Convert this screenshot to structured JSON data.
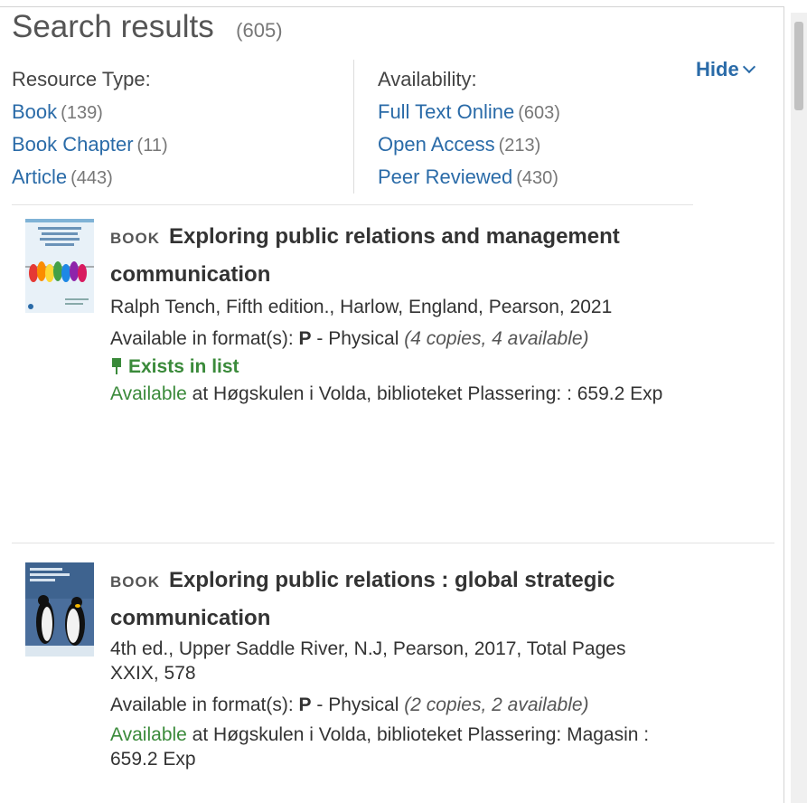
{
  "header": {
    "title": "Search results",
    "count": "(605)",
    "hide_label": "Hide"
  },
  "facets": {
    "resource_type": {
      "label": "Resource Type:",
      "items": [
        {
          "label": "Book",
          "count": "(139)"
        },
        {
          "label": "Book Chapter",
          "count": "(11)"
        },
        {
          "label": "Article",
          "count": "(443)"
        }
      ]
    },
    "availability": {
      "label": "Availability:",
      "items": [
        {
          "label": "Full Text Online",
          "count": "(603)"
        },
        {
          "label": "Open Access",
          "count": "(213)"
        },
        {
          "label": "Peer Reviewed",
          "count": "(430)"
        }
      ]
    }
  },
  "results": [
    {
      "type": "BOOK",
      "title": "Exploring public relations and management communication",
      "meta": "Ralph Tench, Fifth edition., Harlow, England, Pearson, 2021",
      "format_prefix": "Available in format(s): ",
      "format_code": "P",
      "format_text": " - Physical ",
      "copies": "(4 copies, 4 available)",
      "exists_label": "Exists in list",
      "avail_word": "Available",
      "avail_rest": " at Høgskulen i Volda, biblioteket Plassering: : 659.2 Exp",
      "cover_title": "Exploring Public Relations and Management Communication"
    },
    {
      "type": "BOOK",
      "title": "Exploring public relations : global strategic communication",
      "meta": "4th ed., Upper Saddle River, N.J, Pearson, 2017, Total Pages XXIX, 578",
      "format_prefix": "Available in format(s): ",
      "format_code": "P",
      "format_text": " - Physical ",
      "copies": "(2 copies, 2 available)",
      "avail_word": "Available",
      "avail_rest": " at Høgskulen i Volda, biblioteket Plassering: Magasin : 659.2 Exp",
      "cover_title": "Exploring Public Relations"
    }
  ],
  "colors": {
    "link": "#2a6ba8",
    "available": "#3a8a3a"
  }
}
